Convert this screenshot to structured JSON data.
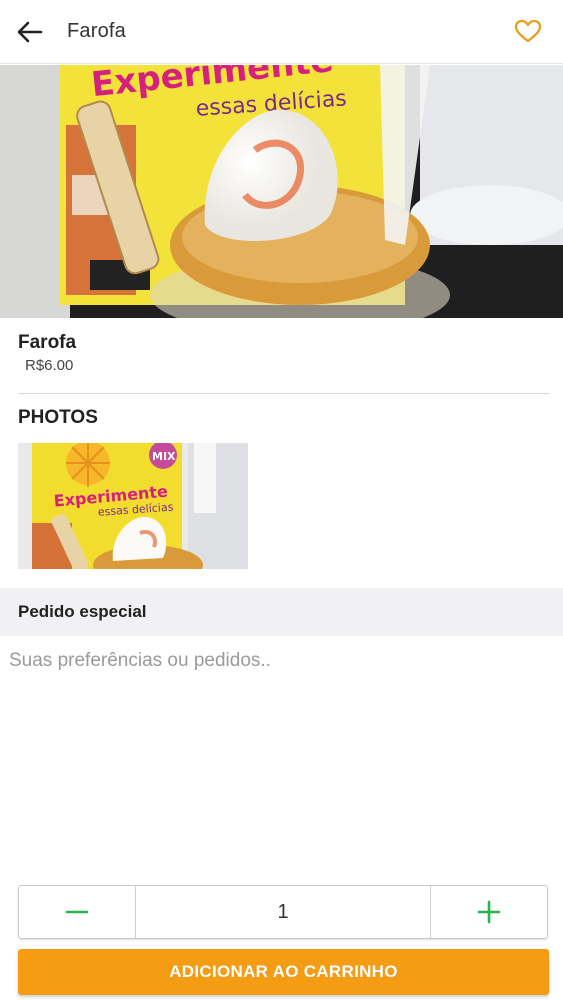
{
  "header": {
    "title": "Farofa",
    "back_icon": "arrow-left-icon",
    "favorite_icon": "heart-outline-icon",
    "favorite_color": "#E6A01E"
  },
  "hero": {
    "banner_line1": "Experimente",
    "banner_line2": "essas delícias"
  },
  "product": {
    "name": "Farofa",
    "price": "R$6.00"
  },
  "photos": {
    "heading": "PHOTOS",
    "thumbnail_brand": "MIX",
    "thumbnail_line1": "Experimente",
    "thumbnail_line2": "essas delícias"
  },
  "special_request": {
    "label": "Pedido especial",
    "placeholder": "Suas preferências ou pedidos..",
    "value": ""
  },
  "quantity": {
    "value": "1",
    "decrement_icon": "minus-icon",
    "increment_icon": "plus-icon",
    "control_color": "#2BB24C"
  },
  "cart_button": {
    "label": "ADICIONAR AO CARRINHO",
    "color": "#F39C14"
  }
}
